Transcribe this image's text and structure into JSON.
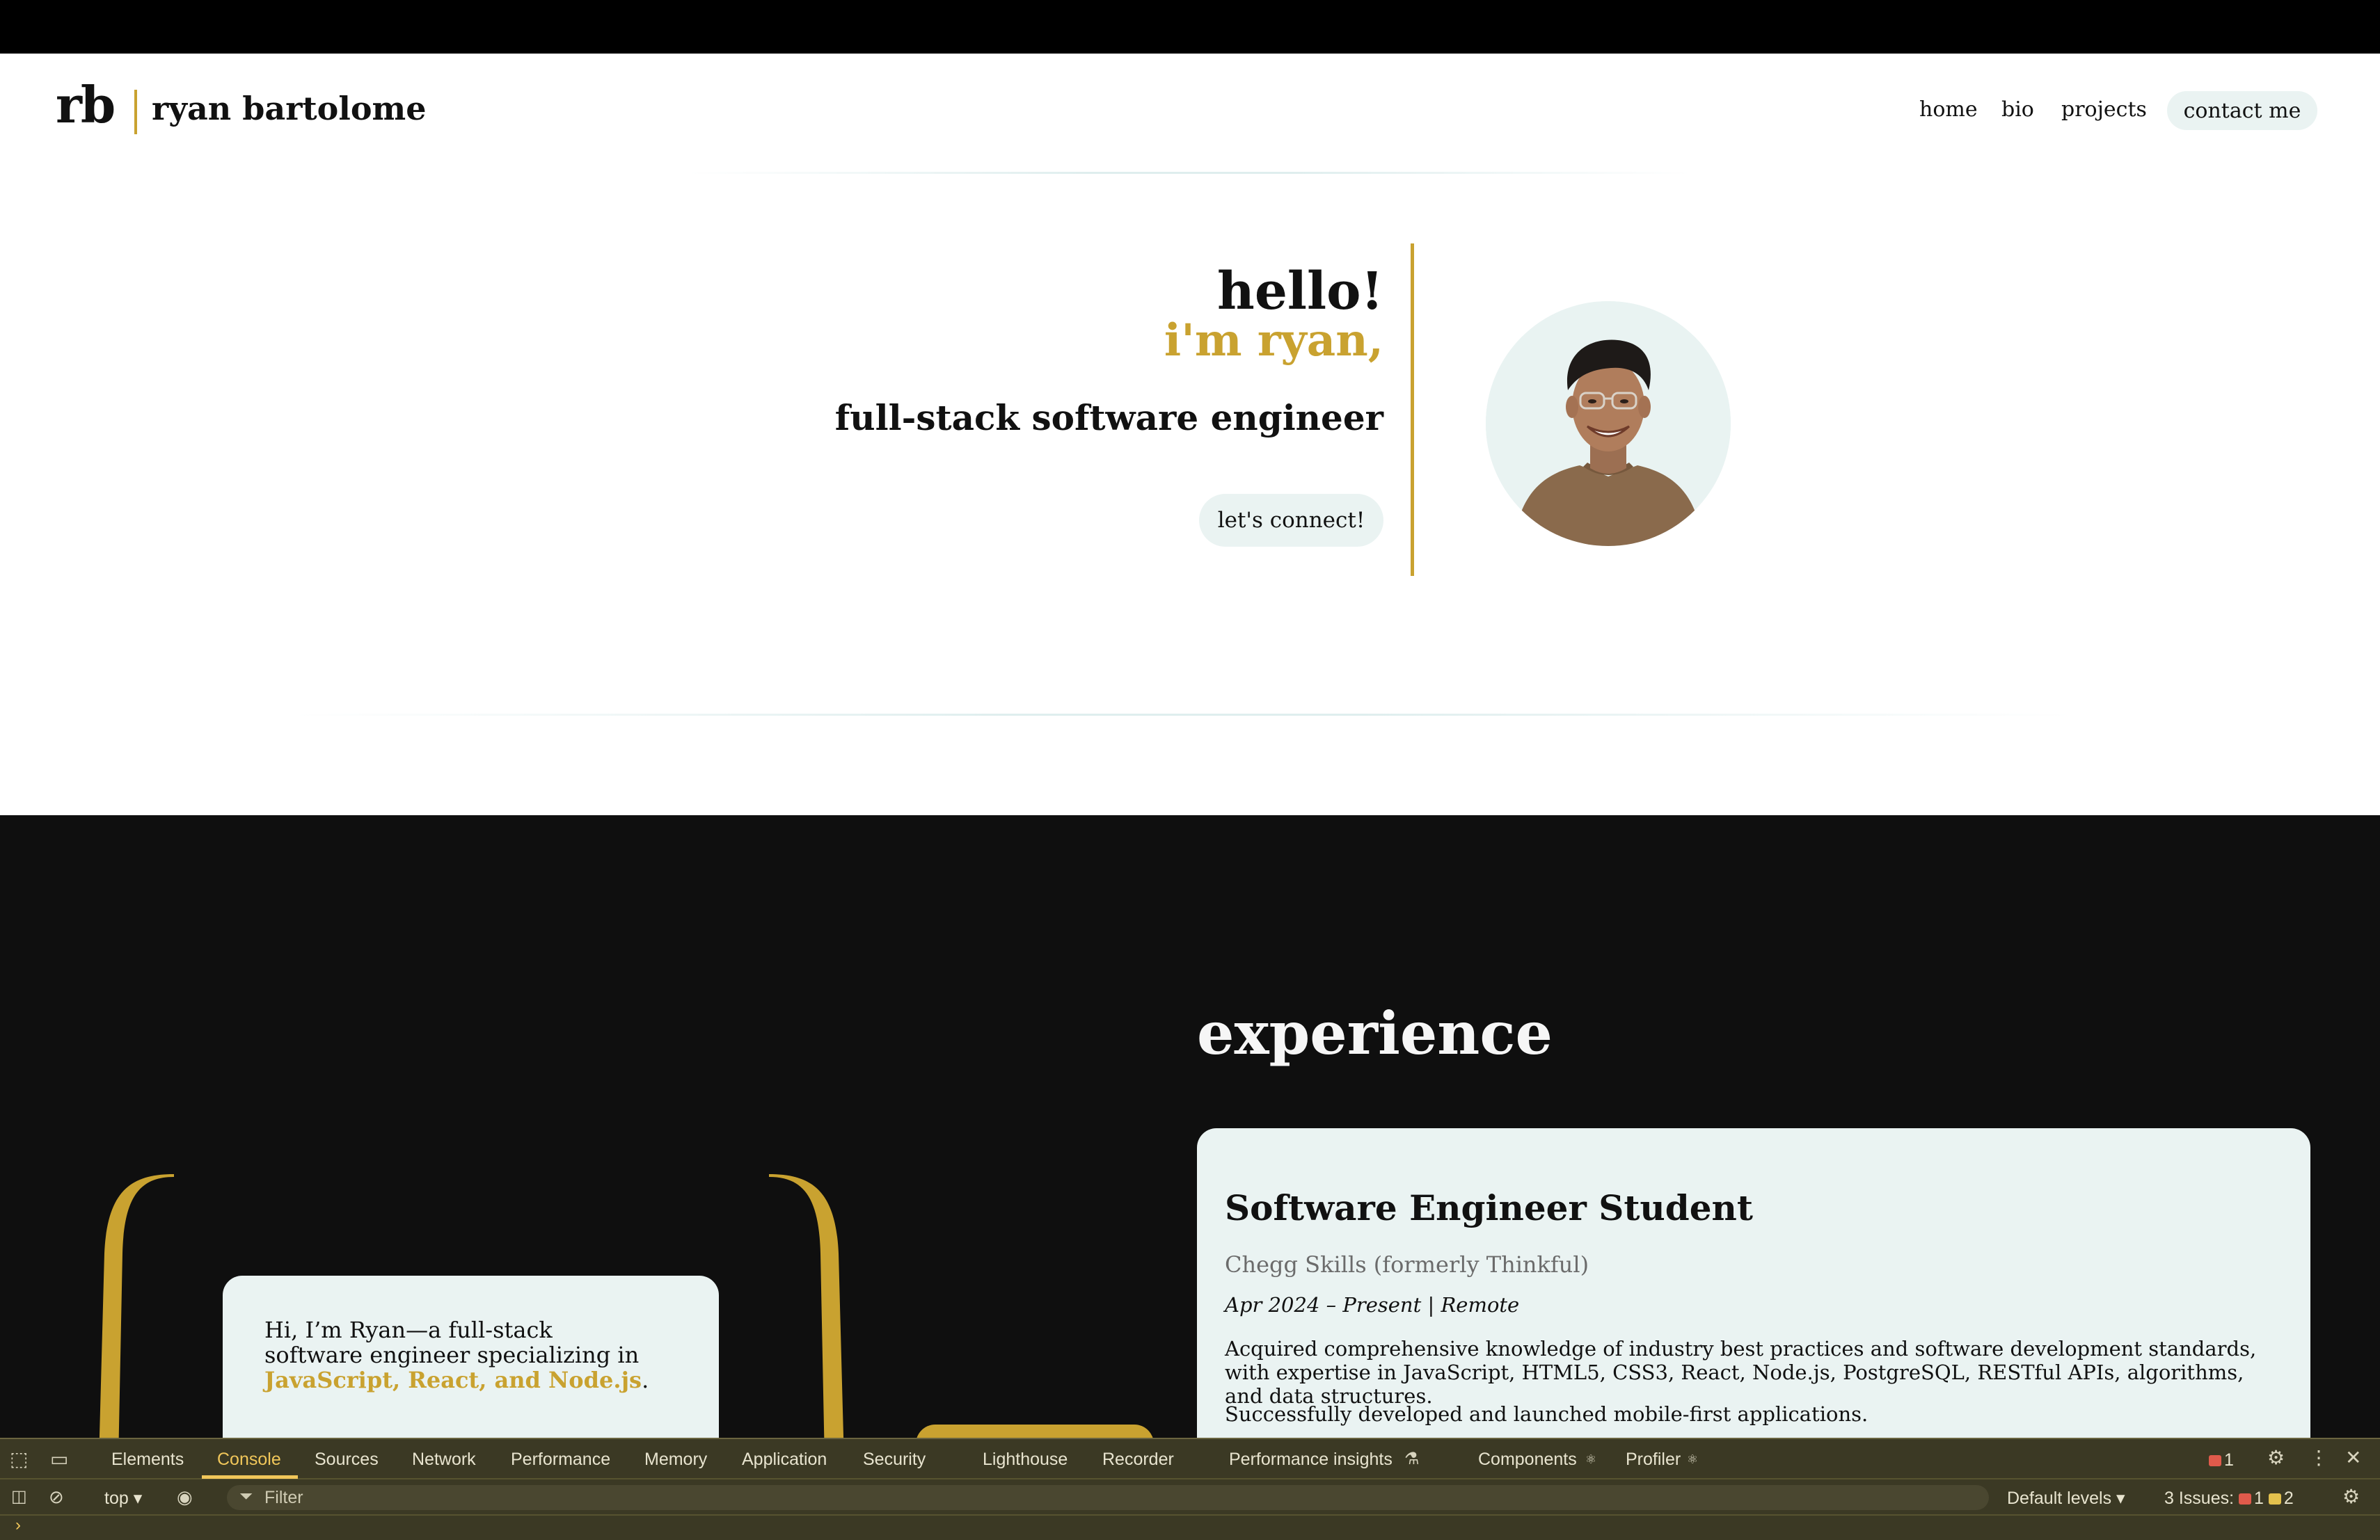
{
  "nav": {
    "logo_mark": "rb",
    "logo_name": "ryan bartolome",
    "links": {
      "home": "home",
      "bio": "bio",
      "projects": "projects",
      "contact": "contact me"
    }
  },
  "hero": {
    "greeting": "hello!",
    "name_line": "i'm ryan,",
    "role": "full-stack software engineer",
    "cta": "let's connect!"
  },
  "bio": {
    "text_prefix": "Hi, I’m Ryan—a full-stack software engineer specializing in ",
    "highlight": "JavaScript, React, and Node.js",
    "text_suffix": "."
  },
  "experience": {
    "title": "experience",
    "job": {
      "title": "Software Engineer Student",
      "company": "Chegg Skills (formerly Thinkful)",
      "dates": "Apr 2024 – Present | Remote",
      "desc_1": "Acquired comprehensive knowledge of industry best practices and software development standards, with expertise in JavaScript, HTML5, CSS3, React, Node.js, PostgreSQL, RESTful APIs, algorithms, and data structures.",
      "desc_2": "Successfully developed and launched mobile-first applications."
    }
  },
  "devtools": {
    "tabs": {
      "elements": "Elements",
      "console": "Console",
      "sources": "Sources",
      "network": "Network",
      "performance": "Performance",
      "memory": "Memory",
      "application": "Application",
      "security": "Security",
      "lighthouse": "Lighthouse",
      "recorder": "Recorder",
      "perf_insights": "Performance insights",
      "components": "Components",
      "profiler": "Profiler"
    },
    "error_count": "1",
    "context": "top",
    "filter_placeholder": "Filter",
    "levels": "Default levels",
    "issues_label": "3 Issues:",
    "issues_errors": "1",
    "issues_warnings": "2",
    "prompt": "›"
  },
  "colors": {
    "accent": "#c9a230",
    "mint": "#eaf3f2",
    "dark": "#0f0f0f",
    "devtools_bg": "#3b3924"
  }
}
